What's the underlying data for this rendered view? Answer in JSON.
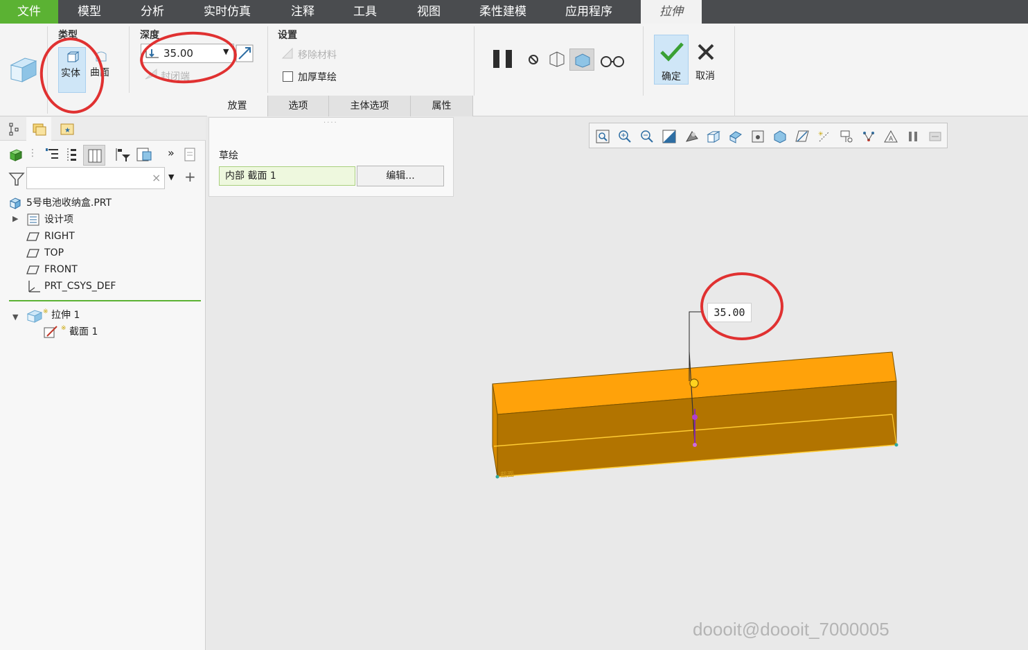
{
  "menu": {
    "items": [
      "文件",
      "模型",
      "分析",
      "实时仿真",
      "注释",
      "工具",
      "视图",
      "柔性建模",
      "应用程序",
      "拉伸"
    ]
  },
  "ribbon": {
    "type_group": {
      "label": "类型",
      "solid": "实体",
      "surface": "曲面"
    },
    "depth_group": {
      "label": "深度",
      "value": "35.00",
      "capped_ends": "封闭端"
    },
    "settings_group": {
      "label": "设置",
      "remove_material": "移除材料",
      "thicken_sketch": "加厚草绘"
    },
    "actions": {
      "ok": "确定",
      "cancel": "取消"
    },
    "subtabs": [
      "放置",
      "选项",
      "主体选项",
      "属性"
    ]
  },
  "placement_panel": {
    "sketch_label": "草绘",
    "section_value": "内部 截面 1",
    "edit_button": "编辑..."
  },
  "model_tree": {
    "root": "5号电池收纳盒.PRT",
    "items": [
      "设计项",
      "RIGHT",
      "TOP",
      "FRONT",
      "PRT_CSYS_DEF"
    ],
    "feature": "拉伸 1",
    "feature_child": "截面 1"
  },
  "viewport": {
    "dimension_value": "35.00",
    "section_tag": "截面",
    "watermark": "doooit@doooit_7000005"
  },
  "colors": {
    "menu_bg": "#4a4c4f",
    "file_tab": "#5bb233",
    "solid_top": "#ffa20a",
    "solid_front": "#b27400",
    "annotation_red": "#e03131"
  }
}
